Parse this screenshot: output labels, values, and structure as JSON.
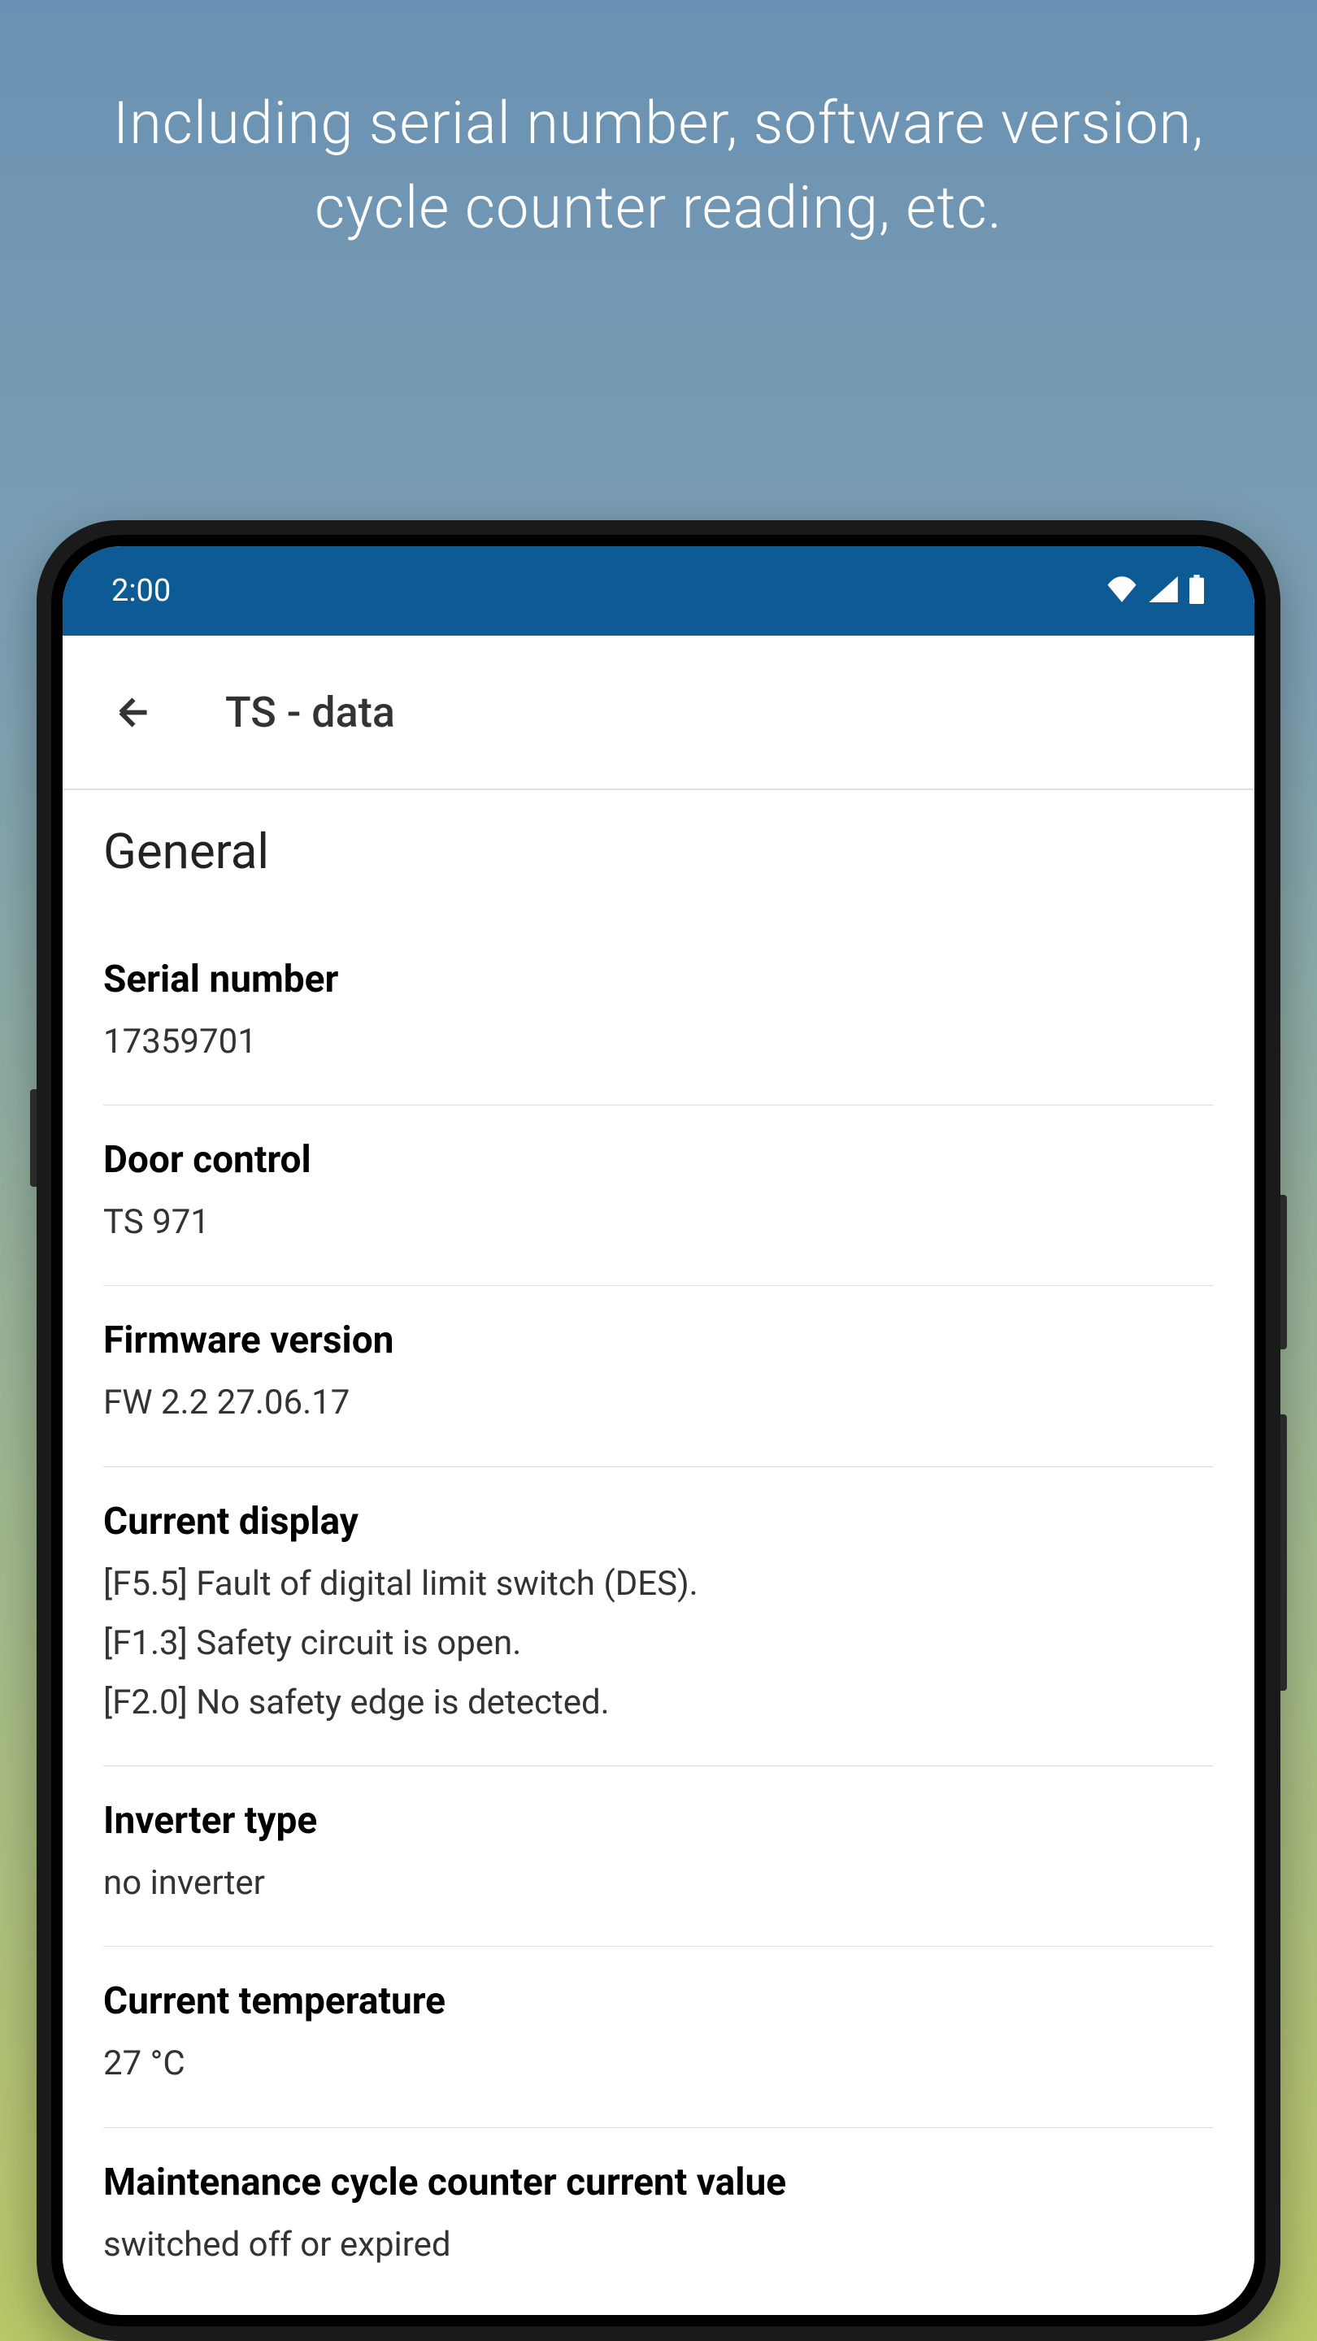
{
  "promo": {
    "text": "Including serial number, software version, cycle counter reading, etc."
  },
  "statusBar": {
    "time": "2:00"
  },
  "header": {
    "title": "TS - data"
  },
  "section": {
    "title": "General"
  },
  "items": [
    {
      "label": "Serial number",
      "values": [
        "17359701"
      ]
    },
    {
      "label": "Door control",
      "values": [
        "TS 971"
      ]
    },
    {
      "label": "Firmware version",
      "values": [
        "FW 2.2 27.06.17"
      ]
    },
    {
      "label": "Current display",
      "values": [
        "[F5.5] Fault of digital limit switch (DES).",
        "[F1.3] Safety circuit is open.",
        "[F2.0] No safety edge is detected."
      ]
    },
    {
      "label": "Inverter type",
      "values": [
        "no inverter"
      ]
    },
    {
      "label": "Current temperature",
      "values": [
        "27 °C"
      ]
    },
    {
      "label": "Maintenance cycle counter current value",
      "values": [
        "switched off or expired"
      ]
    }
  ]
}
